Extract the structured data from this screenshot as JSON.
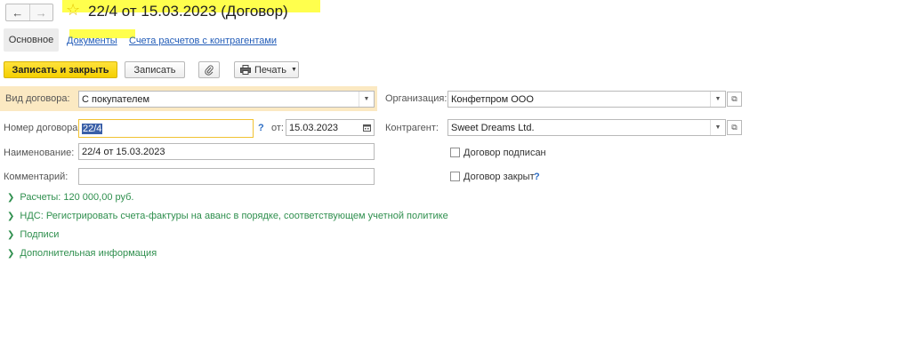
{
  "window": {
    "title": "22/4 от 15.03.2023 (Договор)",
    "nav_back": "←",
    "nav_forward": "→"
  },
  "tabs": [
    {
      "label": "Основное"
    },
    {
      "label": "Документы"
    },
    {
      "label": "Счета расчетов с контрагентами"
    }
  ],
  "toolbar": {
    "save_close_label": "Записать и закрыть",
    "save_label": "Записать",
    "print_label": "Печать"
  },
  "form": {
    "vid_label": "Вид договора:",
    "vid_value": "С покупателем",
    "org_label": "Организация:",
    "org_value": "Конфетпром ООО",
    "nomer_label": "Номер договора:",
    "nomer_value": "22/4",
    "help_mark": "?",
    "ot_label": "от:",
    "ot_value": "15.03.2023",
    "kontragent_label": "Контрагент:",
    "kontragent_value": "Sweet Dreams Ltd.",
    "naim_label": "Наименование:",
    "naim_value": "22/4 от 15.03.2023",
    "comment_label": "Комментарий:",
    "comment_value": "",
    "podpisan_label": "Договор подписан",
    "zakryt_label": "Договор закрыт"
  },
  "sections": [
    {
      "label": "Расчеты: 120 000,00 руб."
    },
    {
      "label": "НДС: Регистрировать счета-фактуры на аванс в порядке, соответствующем учетной политике"
    },
    {
      "label": "Подписи"
    },
    {
      "label": "Дополнительная информация"
    }
  ],
  "icons": {
    "star": "star-icon",
    "clip": "paperclip-icon",
    "printer": "printer-icon",
    "calendar": "calendar-icon",
    "open": "open-form-icon"
  },
  "colors": {
    "accent_yellow": "#f4cf00",
    "highlight": "#ffff4d",
    "link": "#225cb8",
    "section_green": "#2f8f4e"
  }
}
